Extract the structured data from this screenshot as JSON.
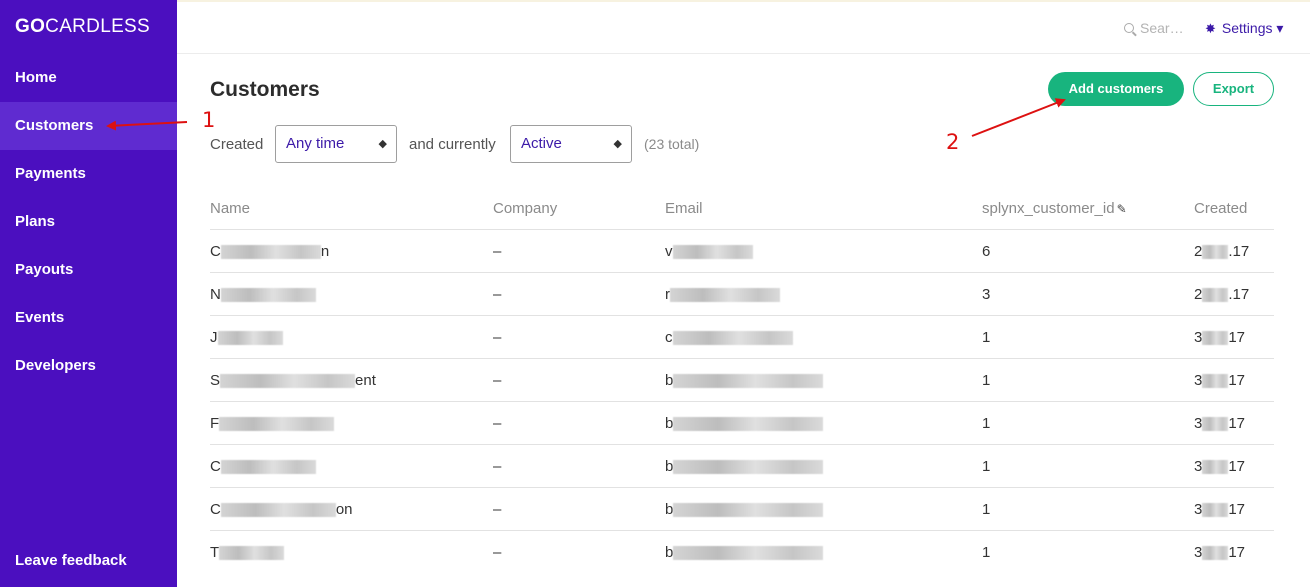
{
  "sidebar": {
    "logo_bold": "GO",
    "logo_rest": "CARDLESS",
    "items": [
      {
        "label": "Home"
      },
      {
        "label": "Customers"
      },
      {
        "label": "Payments"
      },
      {
        "label": "Plans"
      },
      {
        "label": "Payouts"
      },
      {
        "label": "Events"
      },
      {
        "label": "Developers"
      }
    ],
    "active_index": 1,
    "feedback": "Leave feedback"
  },
  "topbar": {
    "search_placeholder": "Sear…",
    "settings_label": "Settings ▾"
  },
  "page": {
    "title": "Customers",
    "add_button": "Add customers",
    "export_button": "Export"
  },
  "filters": {
    "created_label": "Created",
    "created_value": "Any time",
    "currently_label": "and currently",
    "status_value": "Active",
    "total": "(23 total)"
  },
  "table": {
    "headers": [
      "Name",
      "Company",
      "Email",
      "splynx_customer_id",
      "Created"
    ],
    "rows": [
      {
        "name_start": "C",
        "name_end": "n",
        "company": "–",
        "email_start": "v",
        "splynx_id": "6",
        "created_start": "2",
        "created_end": ".17"
      },
      {
        "name_start": "N",
        "name_end": "",
        "company": "–",
        "email_start": "r",
        "splynx_id": "3",
        "created_start": "2",
        "created_end": ".17"
      },
      {
        "name_start": "J",
        "name_end": "",
        "company": "–",
        "email_start": "c",
        "splynx_id": "1",
        "created_start": "3",
        "created_end": "17"
      },
      {
        "name_start": "S",
        "name_end": "ent",
        "company": "–",
        "email_start": "b",
        "splynx_id": "1",
        "created_start": "3",
        "created_end": "17"
      },
      {
        "name_start": "F",
        "name_end": "",
        "company": "–",
        "email_start": "b",
        "splynx_id": "1",
        "created_start": "3",
        "created_end": "17"
      },
      {
        "name_start": "C",
        "name_end": "",
        "company": "–",
        "email_start": "b",
        "splynx_id": "1",
        "created_start": "3",
        "created_end": "17"
      },
      {
        "name_start": "C",
        "name_end": "on",
        "company": "–",
        "email_start": "b",
        "splynx_id": "1",
        "created_start": "3",
        "created_end": "17"
      },
      {
        "name_start": "T",
        "name_end": "",
        "company": "–",
        "email_start": "b",
        "splynx_id": "1",
        "created_start": "3",
        "created_end": "17"
      }
    ]
  },
  "annotations": {
    "label_1": "1",
    "label_2": "2",
    "color": "#dd1111"
  },
  "colors": {
    "sidebar": "#4b0fbf",
    "accent_green": "#18b47e",
    "link_purple": "#3c1aa8"
  }
}
